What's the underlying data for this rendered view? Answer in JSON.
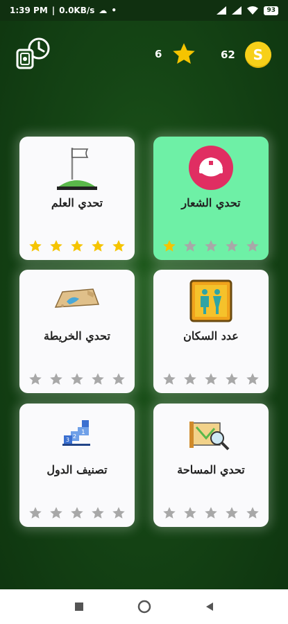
{
  "status": {
    "time": "1:39 PM",
    "speed": "0.0KB/s",
    "battery": "93"
  },
  "header": {
    "stars_count": "6",
    "coins_count": "62",
    "coin_symbol": "S"
  },
  "colors": {
    "star_on": "#f5c400",
    "star_off": "#a8a8a8",
    "active_card": "#6ef0a6"
  },
  "cards": [
    {
      "title": "تحدي الشعار",
      "icon": "police-cap-icon",
      "stars_filled": 1,
      "stars_total": 5
    },
    {
      "title": "تحدي العلم",
      "icon": "flag-icon",
      "stars_filled": 5,
      "stars_total": 5
    },
    {
      "title": "عدد السكان",
      "icon": "population-icon",
      "stars_filled": 0,
      "stars_total": 5
    },
    {
      "title": "تحدي الخريطة",
      "icon": "map-icon",
      "stars_filled": 0,
      "stars_total": 5
    },
    {
      "title": "تحدي المساحة",
      "icon": "area-icon",
      "stars_filled": 0,
      "stars_total": 5
    },
    {
      "title": "تصنيف الدول",
      "icon": "podium-icon",
      "stars_filled": 0,
      "stars_total": 5
    }
  ]
}
